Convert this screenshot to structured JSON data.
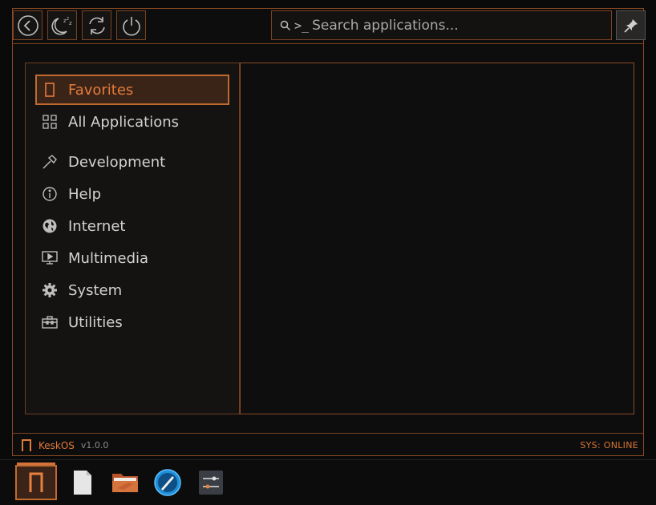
{
  "search": {
    "prompt": ">_",
    "placeholder": "Search applications..."
  },
  "top_buttons": [
    "back",
    "sleep",
    "restart",
    "power"
  ],
  "categories": [
    {
      "label": "Favorites",
      "icon": "bookmark-icon",
      "active": true
    },
    {
      "label": "All Applications",
      "icon": "grid-icon"
    },
    {
      "label": "Development",
      "icon": "hammer-icon"
    },
    {
      "label": "Help",
      "icon": "info-icon"
    },
    {
      "label": "Internet",
      "icon": "globe-icon"
    },
    {
      "label": "Multimedia",
      "icon": "monitor-play-icon"
    },
    {
      "label": "System",
      "icon": "gear-icon"
    },
    {
      "label": "Utilities",
      "icon": "toolbox-icon"
    }
  ],
  "status": {
    "brand": "KeskOS",
    "version": "v1.0.0",
    "sys": "SYS: ONLINE"
  },
  "taskbar": [
    "keskos-menu",
    "text-editor",
    "file-manager",
    "browser",
    "settings-mixer"
  ],
  "colors": {
    "accent": "#d4733a",
    "border": "#7a4322",
    "background": "#0e0d0d"
  }
}
